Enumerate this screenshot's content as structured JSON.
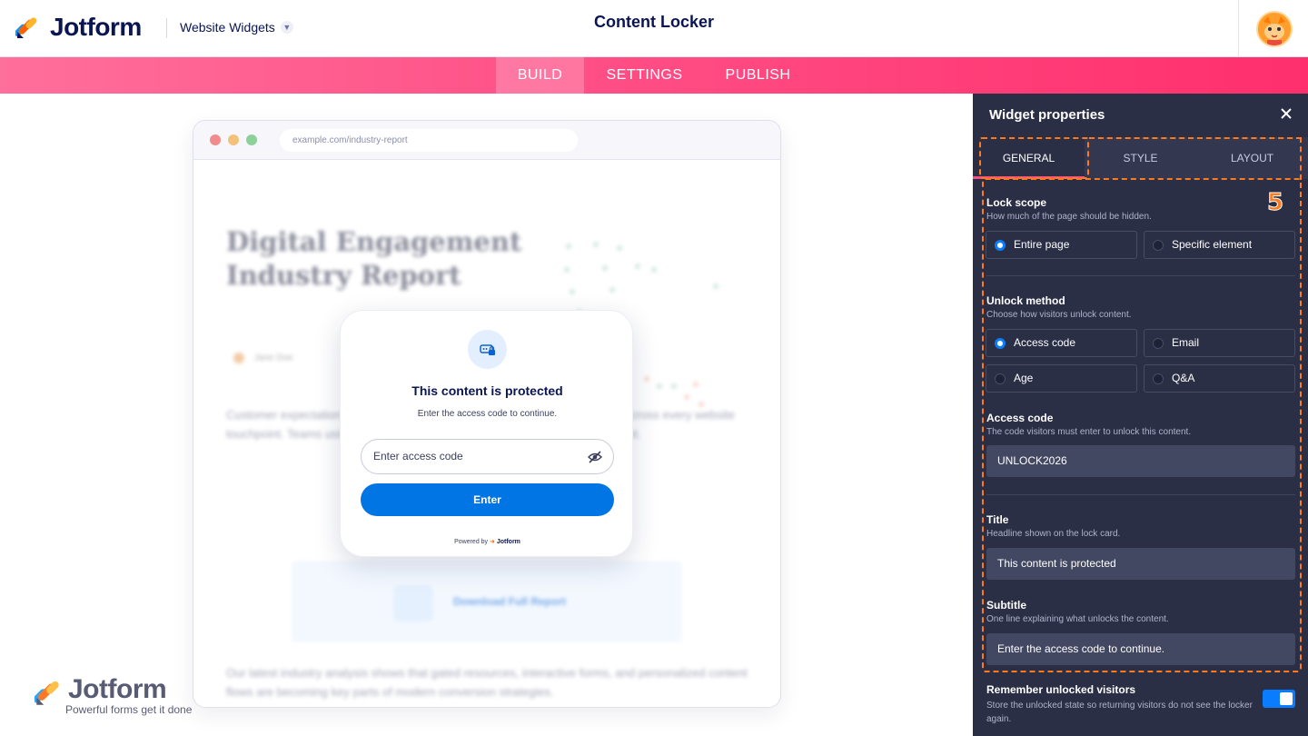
{
  "header": {
    "logo_text": "Jotform",
    "workspace_select": "Website Widgets",
    "app_title": "Content Locker"
  },
  "nav": {
    "tabs": [
      {
        "label": "BUILD",
        "active": true
      },
      {
        "label": "SETTINGS",
        "active": false
      },
      {
        "label": "PUBLISH",
        "active": false
      }
    ]
  },
  "preview": {
    "url": "example.com/industry-report",
    "report_title_line1": "Digital Engagement",
    "report_title_line2": "Industry Report",
    "author": "Jane Doe",
    "para1": "Customer expectations are changing as brands invest in digital experiences across every website touchpoint. Teams using gated insights are seeing stronger visitor engagement.",
    "download_label": "Download Full Report",
    "para2": "Our latest industry analysis shows that gated resources, interactive forms, and personalized content flows are becoming key parts of modern conversion strategies."
  },
  "lock_card": {
    "title": "This content is protected",
    "subtitle": "Enter the access code to continue.",
    "input_placeholder": "Enter access code",
    "button_label": "Enter",
    "powered_prefix": "Powered by",
    "powered_brand": "Jotform"
  },
  "watermark": {
    "brand": "Jotform",
    "tagline": "Powerful forms get it done"
  },
  "panel": {
    "title": "Widget properties",
    "tabs": [
      {
        "label": "GENERAL",
        "active": true
      },
      {
        "label": "STYLE",
        "active": false
      },
      {
        "label": "LAYOUT",
        "active": false
      }
    ],
    "annotation_marker": "5",
    "lock_scope": {
      "label": "Lock scope",
      "desc": "How much of the page should be hidden.",
      "options": [
        {
          "label": "Entire page",
          "selected": true
        },
        {
          "label": "Specific element",
          "selected": false
        }
      ]
    },
    "unlock_method": {
      "label": "Unlock method",
      "desc": "Choose how visitors unlock content.",
      "options": [
        {
          "label": "Access code",
          "selected": true
        },
        {
          "label": "Email",
          "selected": false
        },
        {
          "label": "Age",
          "selected": false
        },
        {
          "label": "Q&A",
          "selected": false
        }
      ]
    },
    "access_code": {
      "label": "Access code",
      "desc": "The code visitors must enter to unlock this content.",
      "value": "UNLOCK2026"
    },
    "title_field": {
      "label": "Title",
      "desc": "Headline shown on the lock card.",
      "value": "This content is protected"
    },
    "subtitle_field": {
      "label": "Subtitle",
      "desc": "One line explaining what unlocks the content.",
      "value": "Enter the access code to continue."
    },
    "remember": {
      "label": "Remember unlocked visitors",
      "desc": "Store the unlocked state so returning visitors do not see the locker again.",
      "enabled": true
    }
  },
  "colors": {
    "brand_navy": "#0a1551",
    "nav_pink": "#ff4f86",
    "primary_blue": "#0075e3",
    "panel_bg": "#2b2f45",
    "annotation_orange": "#ff7a1a"
  }
}
